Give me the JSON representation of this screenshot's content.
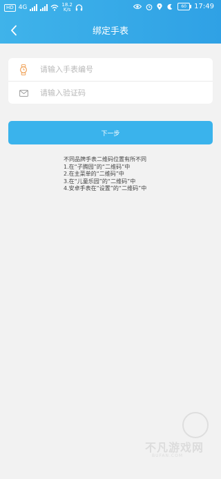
{
  "status_bar": {
    "time": "17:49",
    "net_speed_value": "18.2",
    "net_speed_unit": "K/s",
    "battery": "60",
    "network_label": "4G"
  },
  "header": {
    "title": "绑定手表"
  },
  "form": {
    "watch_number_placeholder": "请输入手表编号",
    "verify_code_placeholder": "请输入验证码"
  },
  "next_button_label": "下一步",
  "tips": [
    "不同品牌手表二维码位置有所不同",
    "1.在“子腾园”的“二维码”中",
    "2.在主菜单的“二维码”中",
    "3.在“儿童乐园”的“二维码”中",
    "4.安卓手表在“设置”的“二维码”中"
  ],
  "watermark": {
    "text": "不凡游戏网",
    "url": "BUFAN.COM"
  },
  "colors": {
    "header": "#3fb3ea",
    "button": "#3ab3ec",
    "icon_orange": "#f0a35a"
  }
}
